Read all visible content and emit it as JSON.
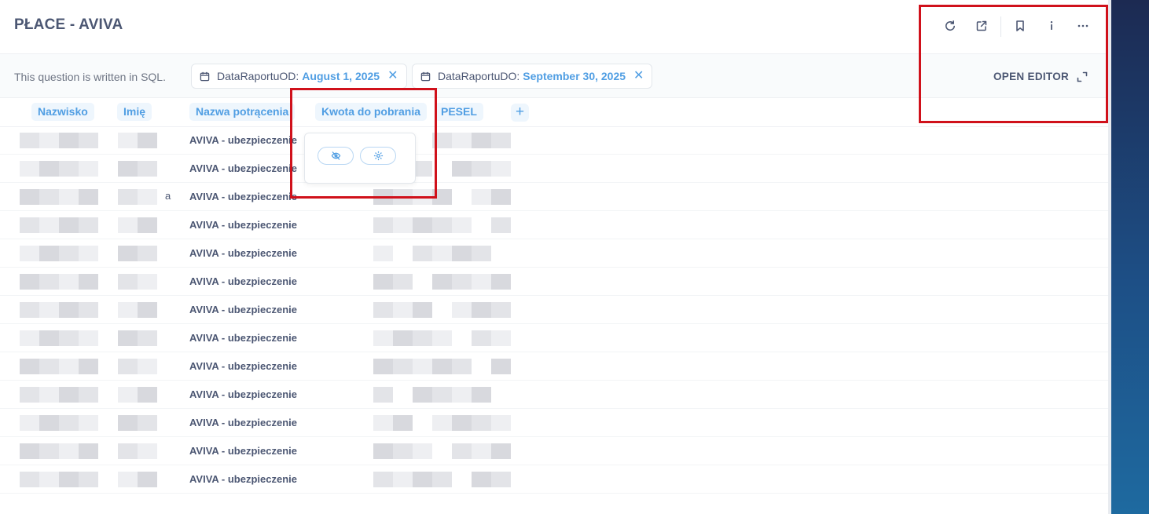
{
  "header": {
    "title": "PŁACE - AVIVA",
    "actions": [
      {
        "name": "refresh-icon"
      },
      {
        "name": "external-link-icon"
      },
      {
        "name": "bookmark-icon"
      },
      {
        "name": "info-icon"
      },
      {
        "name": "more-icon"
      }
    ]
  },
  "filterbar": {
    "sql_note": "This question is written in SQL.",
    "filters": [
      {
        "label": "DataRaportuOD:",
        "value": "August 1, 2025"
      },
      {
        "label": "DataRaportuDO:",
        "value": "September 30, 2025"
      }
    ],
    "open_editor": "OPEN EDITOR"
  },
  "table": {
    "columns": [
      "Nazwisko",
      "Imię",
      "Nazwa potrącenia",
      "Kwota do pobrania",
      "PESEL"
    ],
    "add_column": "+",
    "rows": [
      "AVIVA - ubezpieczenie",
      "AVIVA - ubezpieczenie",
      "AVIVA - ubezpieczenie",
      "AVIVA - ubezpieczenie",
      "AVIVA - ubezpieczenie",
      "AVIVA - ubezpieczenie",
      "AVIVA - ubezpieczenie",
      "AVIVA - ubezpieczenie",
      "AVIVA - ubezpieczenie",
      "AVIVA - ubezpieczenie",
      "AVIVA - ubezpieczenie",
      "AVIVA - ubezpieczenie",
      "AVIVA - ubezpieczenie"
    ],
    "truncated_fragment": "a"
  },
  "column_popover": {
    "buttons": [
      {
        "name": "hide-icon"
      },
      {
        "name": "gear-icon"
      }
    ]
  },
  "colors": {
    "accent": "#509ee3",
    "text": "#4c5773",
    "annotation": "#d0111b"
  }
}
